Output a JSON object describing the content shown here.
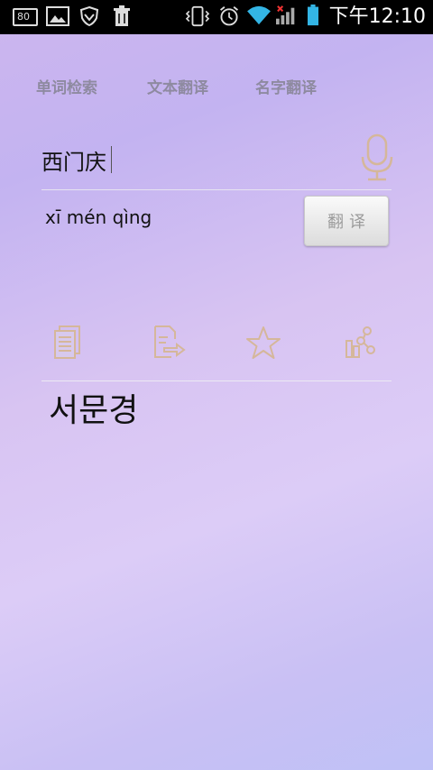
{
  "status_bar": {
    "battery_percent": "80",
    "time": "下午12:10"
  },
  "tabs": [
    {
      "label": "单词检索"
    },
    {
      "label": "文本翻译"
    },
    {
      "label": "名字翻译"
    }
  ],
  "input": {
    "value": "西门庆"
  },
  "pinyin": "xī mén qìng",
  "translate_button": "翻译",
  "result": "서문경",
  "colors": {
    "icon": "#d5b79a",
    "tab_text": "#8e8aa0"
  }
}
